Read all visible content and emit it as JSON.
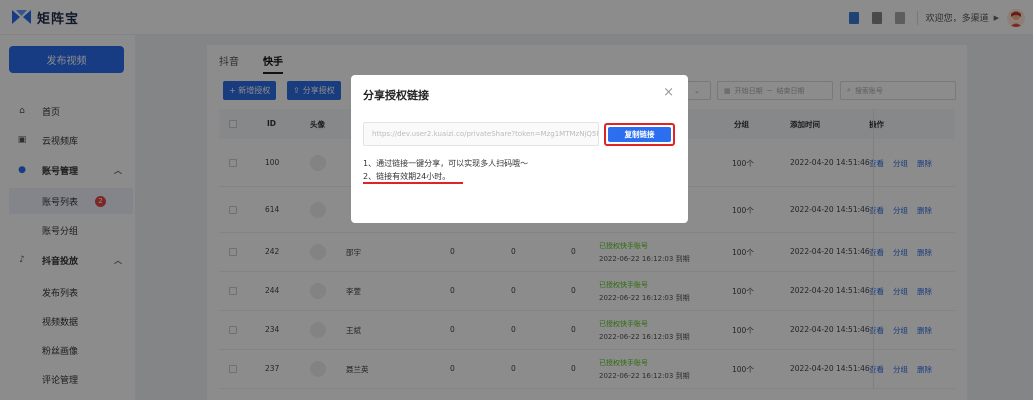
{
  "app": {
    "name": "矩阵宝"
  },
  "header": {
    "welcome": "欢迎您，多渠道"
  },
  "sidebar": {
    "publish_button": "发布视频",
    "items": [
      {
        "label": "首页",
        "icon": "home-icon"
      },
      {
        "label": "云视频库",
        "icon": "cloud-library-icon"
      },
      {
        "label": "账号管理",
        "icon": "user-icon"
      },
      {
        "label": "账号列表",
        "badge": "2"
      },
      {
        "label": "账号分组"
      },
      {
        "label": "抖音投放",
        "icon": "tiktok-icon"
      },
      {
        "label": "发布列表"
      },
      {
        "label": "视频数据"
      },
      {
        "label": "粉丝画像"
      },
      {
        "label": "评论管理"
      }
    ]
  },
  "main": {
    "tabs": [
      "抖音",
      "快手"
    ],
    "toolbar": {
      "add_auth": "+ 新增授权",
      "share_auth": "分享授权"
    },
    "filters": {
      "start_date": "开始日期",
      "end_date": "结束日期",
      "search_placeholder": "搜索账号"
    }
  },
  "table": {
    "headers": {
      "id": "ID",
      "avatar": "头像",
      "group": "分组",
      "added": "添加时间",
      "ops": "操作"
    },
    "rows": [
      {
        "id": "100",
        "name": "",
        "c1": "",
        "c2": "",
        "c3": "",
        "status": "",
        "expire": "",
        "group": "100个",
        "added": "2022-04-20 14:51:46"
      },
      {
        "id": "614",
        "name": "",
        "c1": "",
        "c2": "",
        "c3": "",
        "status": "",
        "expire": "",
        "group": "100个",
        "added": "2022-04-20 14:51:46"
      },
      {
        "id": "242",
        "name": "邵宇",
        "c1": "0",
        "c2": "0",
        "c3": "0",
        "status": "已授权快手账号",
        "expire": "2022-06-22 16:12:03 到期",
        "group": "100个",
        "added": "2022-04-20 14:51:46"
      },
      {
        "id": "244",
        "name": "李萱",
        "c1": "0",
        "c2": "0",
        "c3": "0",
        "status": "已授权快手账号",
        "expire": "2022-06-22 16:12:03 到期",
        "group": "100个",
        "added": "2022-04-20 14:51:46"
      },
      {
        "id": "234",
        "name": "王斌",
        "c1": "0",
        "c2": "0",
        "c3": "0",
        "status": "已授权快手账号",
        "expire": "2022-06-22 16:12:03 到期",
        "group": "100个",
        "added": "2022-04-20 14:51:46"
      },
      {
        "id": "237",
        "name": "聂兰英",
        "c1": "0",
        "c2": "0",
        "c3": "0",
        "status": "已授权快手账号",
        "expire": "2022-06-22 16:12:03 到期",
        "group": "100个",
        "added": "2022-04-20 14:51:46"
      }
    ],
    "ops": {
      "view": "查看",
      "group": "分组",
      "delete": "删除"
    }
  },
  "modal": {
    "title": "分享授权链接",
    "link": "https://dev.user2.kuaizi.co/privateShare?token=Mzg1MTMzNjQ5N",
    "copy_button": "复制链接",
    "tips": [
      "1、通过链接一键分享，可以实现多人扫码哦～",
      "2、链接有效期24小时。"
    ]
  }
}
